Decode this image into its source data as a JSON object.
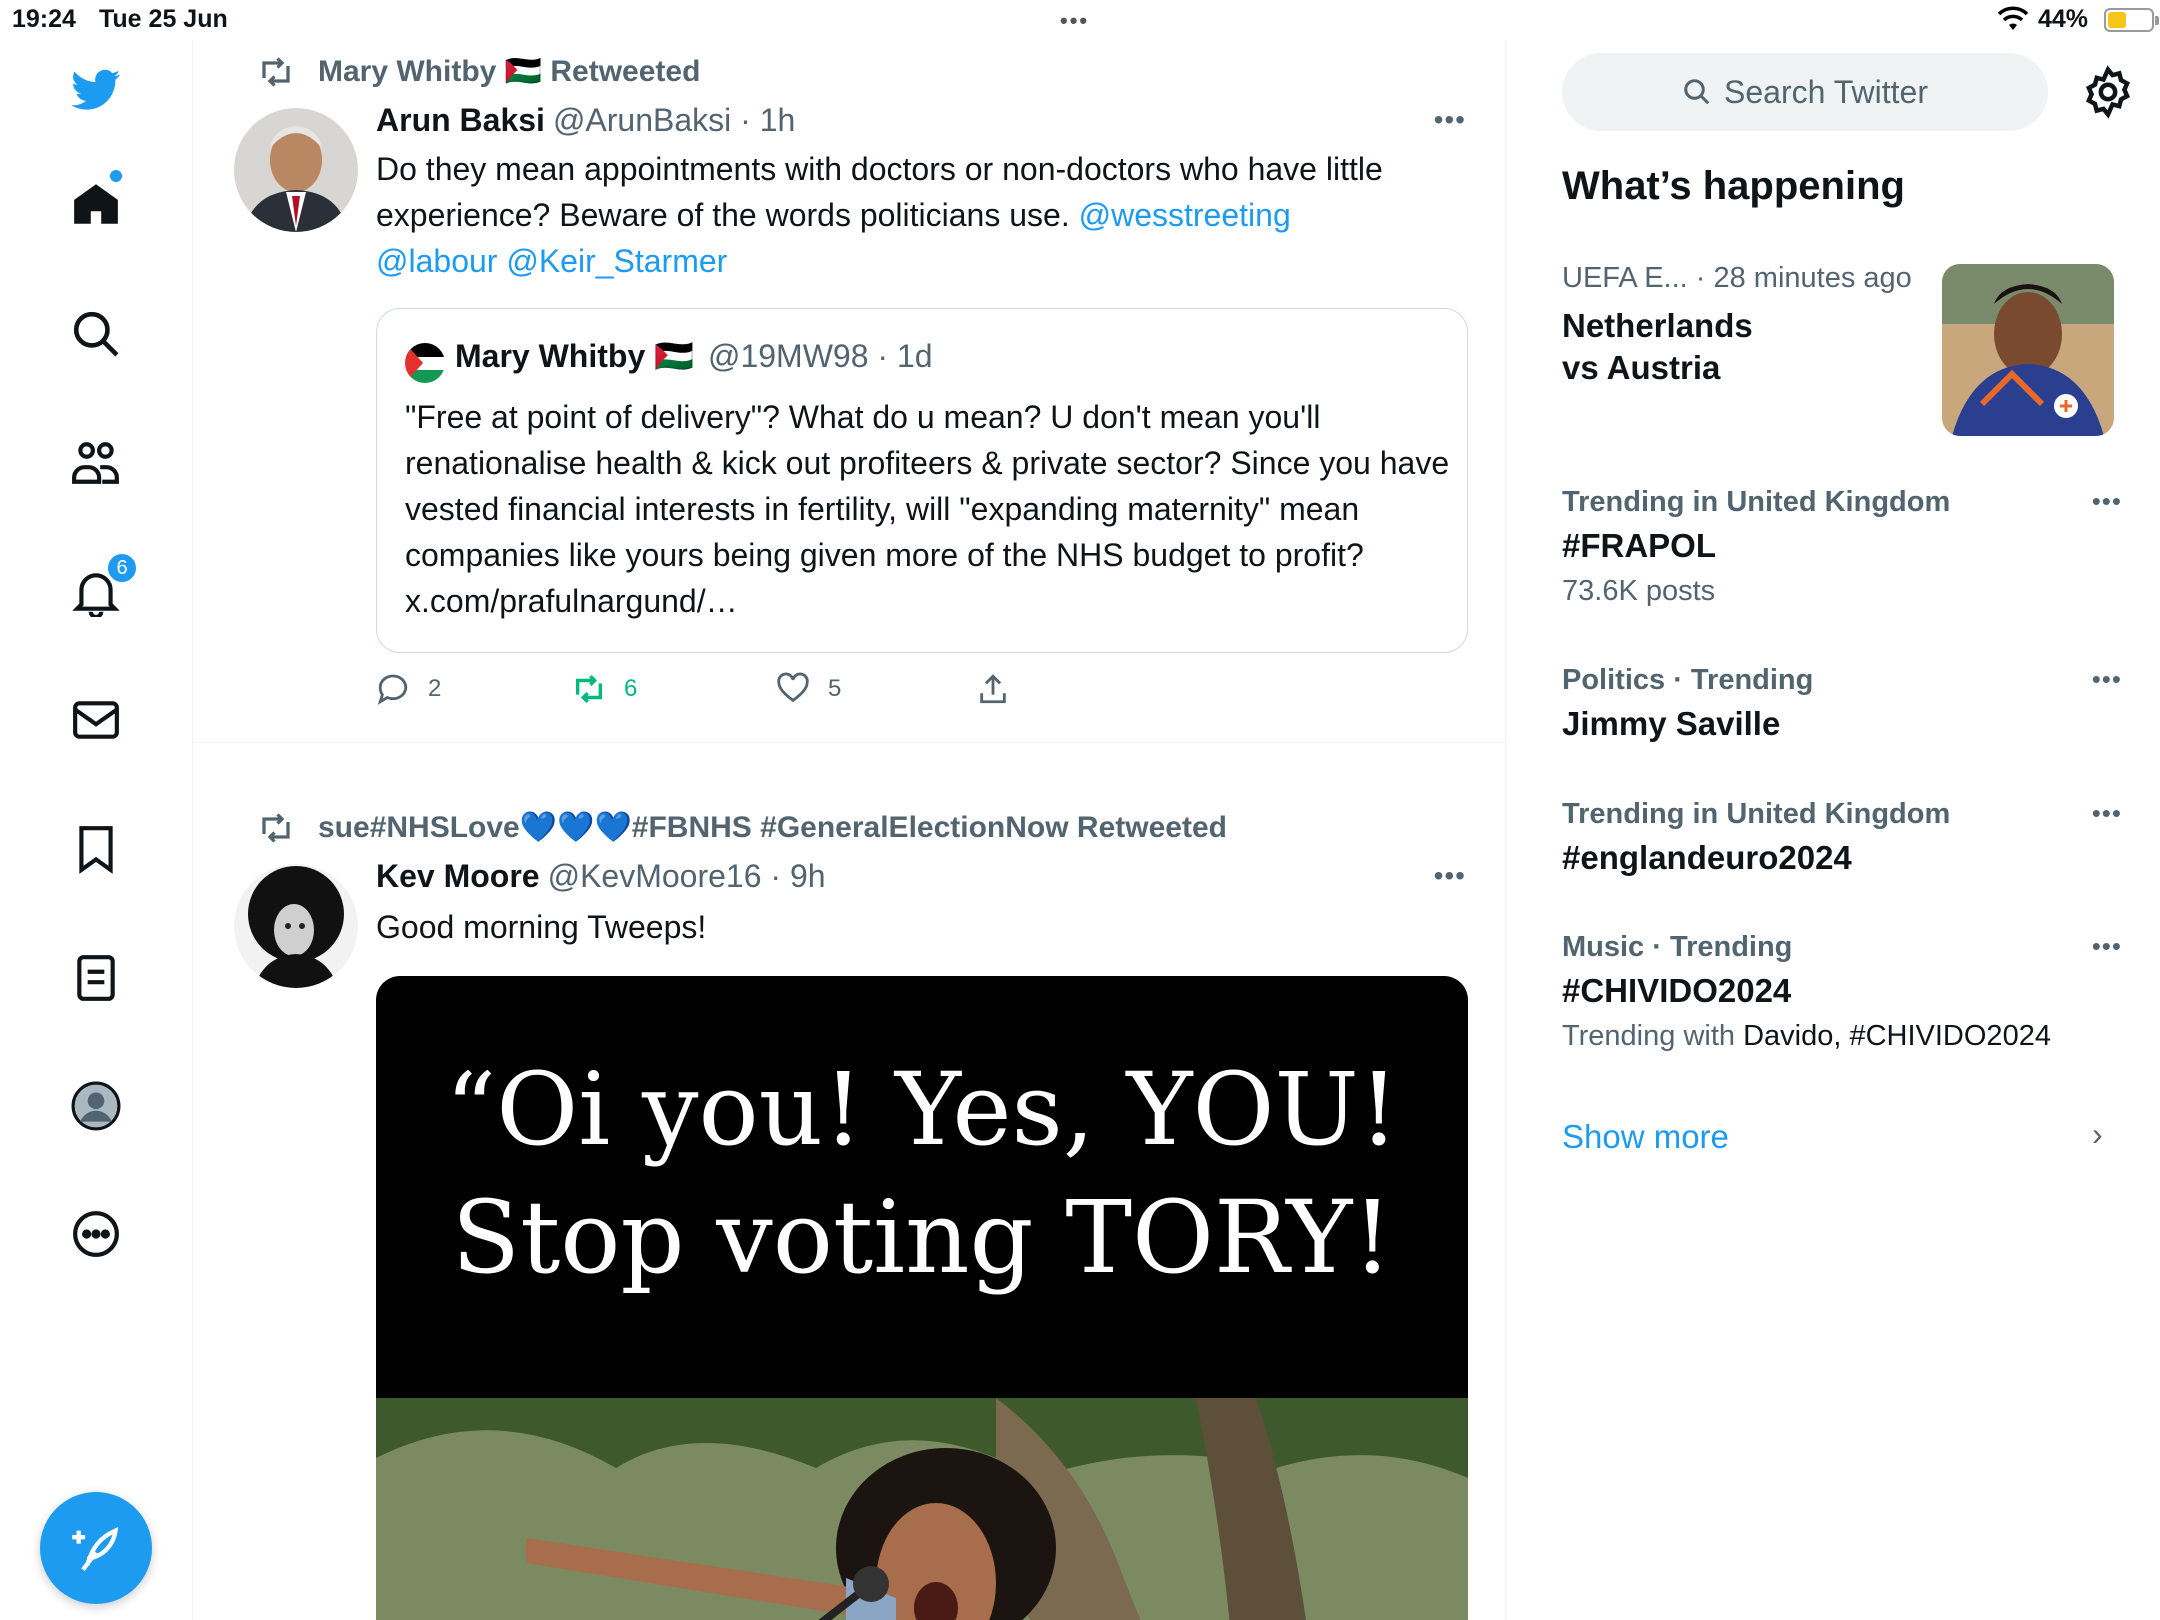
{
  "status_bar": {
    "time": "19:24",
    "date": "Tue 25 Jun",
    "battery": "44%"
  },
  "colors": {
    "accent": "#1d9bf0",
    "retweet": "#00ba7c",
    "muted": "#536471",
    "text": "#0f1419"
  },
  "nav": {
    "notifications_count": "6",
    "icons": [
      "twitter-logo-icon",
      "home-icon",
      "search-icon",
      "communities-icon",
      "bell-icon",
      "mail-icon",
      "bookmark-icon",
      "lists-icon",
      "profile-icon",
      "more-icon"
    ]
  },
  "tweets": [
    {
      "retweeted_by": "Mary Whitby 🇵🇸 Retweeted",
      "name": "Arun Baksi",
      "meta": "@ArunBaksi · 1h",
      "text_plain": "Do they mean appointments with doctors or non-doctors who have little experience? Beware of the words politicians use. ",
      "mention1": "@wesstreeting",
      "mention2": "@labour",
      "mention3": "@Keir_Starmer",
      "quote": {
        "name": "Mary Whitby 🇵🇸",
        "meta": "@19MW98 · 1d",
        "text": "\"Free at point of delivery\"? What do u mean? U don't mean you'll renationalise health & kick out profiteers & private sector? Since you have vested financial interests in fertility, will \"expanding maternity\" mean companies like yours being given more of the NHS budget to profit? x.com/prafulnargund/…"
      },
      "replies": "2",
      "retweets": "6",
      "likes": "5"
    },
    {
      "retweeted_by": "sue#NHSLove💙💙💙#FBNHS #GeneralElectionNow Retweeted",
      "name": "Kev Moore",
      "meta": "@KevMoore16 · 9h",
      "text": "Good morning Tweeps!",
      "image_text_line1": "“Oi you! Yes, YOU!",
      "image_text_line2": "Stop voting TORY!"
    }
  ],
  "sidebar": {
    "search_placeholder": "Search Twitter",
    "section_title": "What’s happening",
    "trends": [
      {
        "category": "UEFA E... · 28 minutes ago",
        "title_line1": "Netherlands",
        "title_line2": "vs Austria"
      },
      {
        "category": "Trending in United Kingdom",
        "title": "#FRAPOL",
        "sub": "73.6K posts"
      },
      {
        "category": "Politics · Trending",
        "title": "Jimmy Saville"
      },
      {
        "category": "Trending in United Kingdom",
        "title": "#englandeuro2024"
      },
      {
        "category": "Music · Trending",
        "title": "#CHIVIDO2024",
        "sub_prefix": "Trending with ",
        "sub_strong": "Davido, #CHIVIDO2024"
      }
    ],
    "show_more": "Show more"
  }
}
